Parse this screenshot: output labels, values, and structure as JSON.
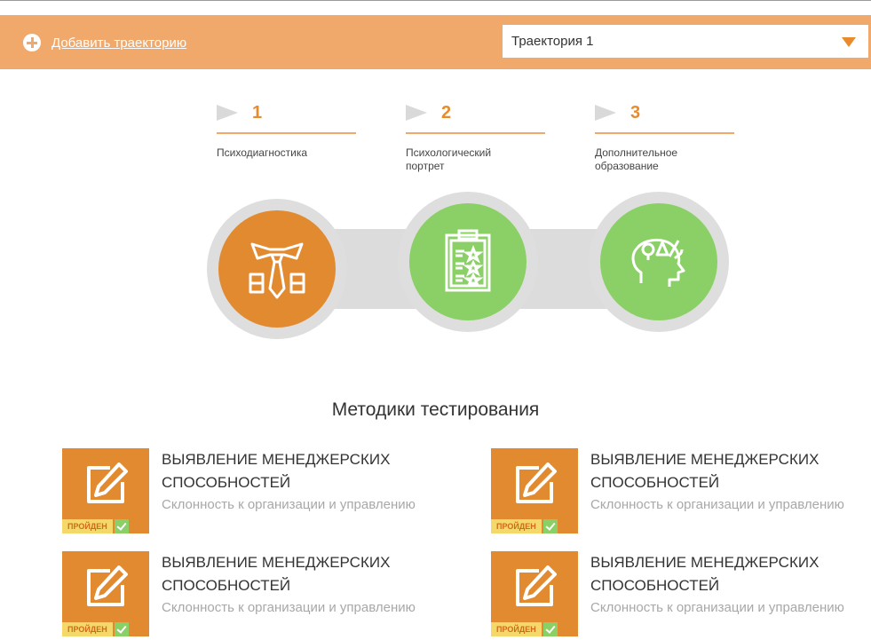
{
  "header": {
    "add_label": "Добавить траекторию",
    "select_value": "Траектория 1",
    "accent": "#f0a96a"
  },
  "steps": [
    {
      "number": "1",
      "title": "Психодиагностика",
      "icon": "tie-suit-icon",
      "color": "#e28a30"
    },
    {
      "number": "2",
      "title": "Психологический портрет",
      "icon": "clipboard-checklist-icon",
      "color": "#8bd066"
    },
    {
      "number": "3",
      "title": "Дополнительное образование",
      "icon": "head-ideas-icon",
      "color": "#8bd066"
    }
  ],
  "section": {
    "title": "Методики тестирования"
  },
  "cards": [
    {
      "title": "ВЫЯВЛЕНИЕ МЕНЕДЖЕРСКИХ СПОСОБНОСТЕЙ",
      "subtitle": "Склонность к организации и управлению",
      "badge": "ПРОЙДЕН",
      "icon": "edit-icon"
    },
    {
      "title": "ВЫЯВЛЕНИЕ МЕНЕДЖЕРСКИХ СПОСОБНОСТЕЙ",
      "subtitle": "Склонность к организации и управлению",
      "badge": "ПРОЙДЕН",
      "icon": "edit-icon"
    },
    {
      "title": "ВЫЯВЛЕНИЕ МЕНЕДЖЕРСКИХ СПОСОБНОСТЕЙ",
      "subtitle": "Склонность к организации и управлению",
      "badge": "ПРОЙДЕН",
      "icon": "edit-icon"
    },
    {
      "title": "ВЫЯВЛЕНИЕ МЕНЕДЖЕРСКИХ СПОСОБНОСТЕЙ",
      "subtitle": "Склонность к организации и управлению",
      "badge": "ПРОЙДЕН",
      "icon": "edit-icon"
    }
  ]
}
